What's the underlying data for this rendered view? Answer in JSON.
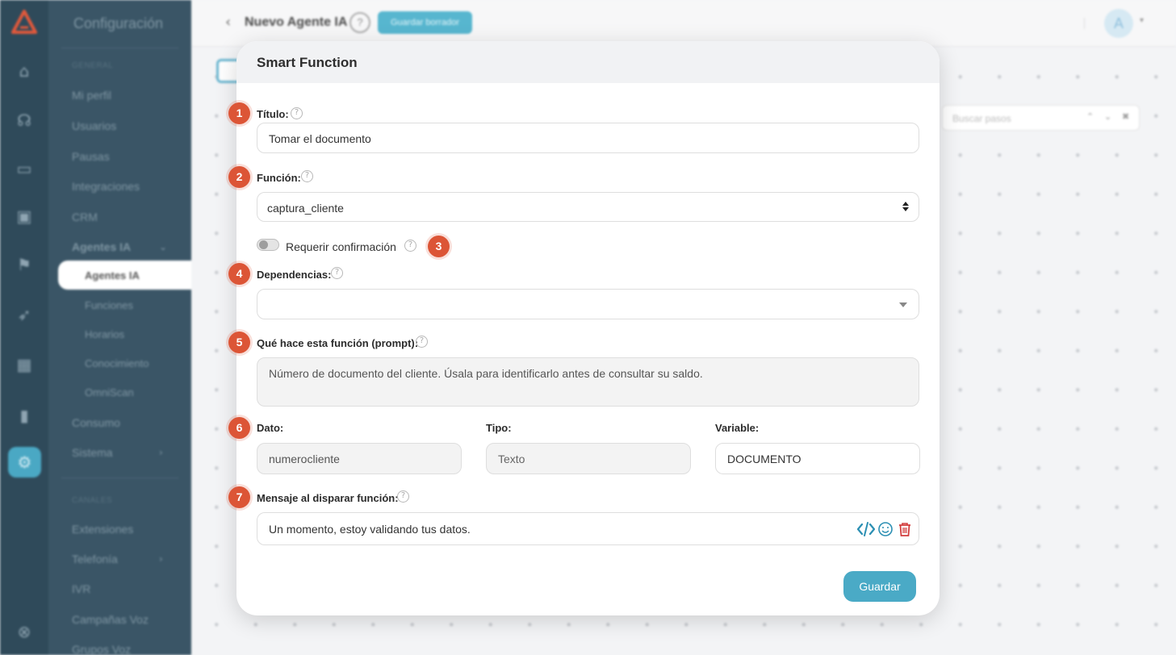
{
  "app": {
    "sidebar_title": "Configuración",
    "sections": {
      "general": "GENERAL",
      "channels": "CANALES"
    },
    "menu": [
      {
        "label": "Mi perfil"
      },
      {
        "label": "Usuarios"
      },
      {
        "label": "Pausas"
      },
      {
        "label": "Integraciones"
      },
      {
        "label": "CRM"
      },
      {
        "label": "Agentes IA"
      },
      {
        "label": "Agentes IA"
      },
      {
        "label": "Funciones"
      },
      {
        "label": "Horarios"
      },
      {
        "label": "Conocimiento"
      },
      {
        "label": "OmniScan"
      },
      {
        "label": "Consumo"
      },
      {
        "label": "Sistema"
      },
      {
        "label": "Extensiones"
      },
      {
        "label": "Telefonía"
      },
      {
        "label": "IVR"
      },
      {
        "label": "Campañas Voz"
      },
      {
        "label": "Grupos Voz"
      }
    ],
    "header": {
      "agent_name": "Nuevo Agente IA",
      "help": "?",
      "save_draft": "Guardar borrador",
      "avatar_initial": "A"
    },
    "search_steps_placeholder": "Buscar pasos",
    "accent_color": "#4aaac6"
  },
  "modal": {
    "title": "Smart Function",
    "badges": [
      "1",
      "2",
      "3",
      "4",
      "5",
      "6",
      "7"
    ],
    "titulo": {
      "label": "Título:",
      "value": "Tomar el documento"
    },
    "funcion": {
      "label": "Función:",
      "value": "captura_cliente"
    },
    "confirm": {
      "label": "Requerir confirmación",
      "enabled": false
    },
    "dependencias": {
      "label": "Dependencias:",
      "value": ""
    },
    "prompt": {
      "label": "Qué hace esta función (prompt):",
      "value": "Número de documento del cliente. Úsala para identificarlo antes de consultar su saldo."
    },
    "dato": {
      "label": "Dato:",
      "value": "numerocliente"
    },
    "tipo": {
      "label": "Tipo:",
      "value": "Texto"
    },
    "variable": {
      "label": "Variable:",
      "value": "DOCUMENTO"
    },
    "mensaje": {
      "label": "Mensaje al disparar función:",
      "value": "Un momento, estoy validando tus datos."
    },
    "save_label": "Guardar",
    "badge_color": "#dc5536"
  }
}
